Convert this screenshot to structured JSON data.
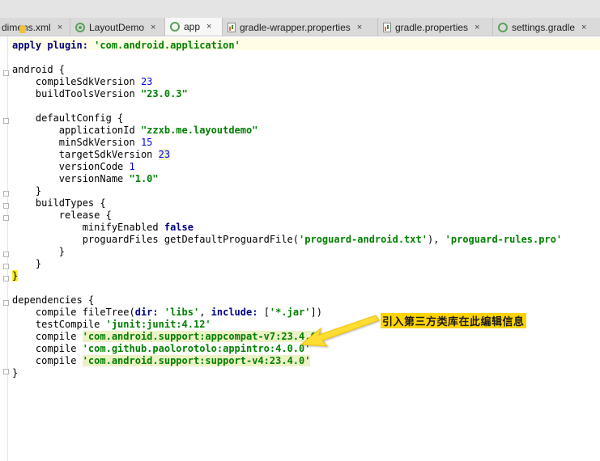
{
  "tabs": [
    {
      "label": "dimens.xml",
      "icon": "xml-file-icon",
      "active": false
    },
    {
      "label": "LayoutDemo",
      "icon": "android-module-icon",
      "active": false
    },
    {
      "label": "app",
      "icon": "gradle-module-icon",
      "active": true
    },
    {
      "label": "gradle-wrapper.properties",
      "icon": "properties-file-icon",
      "active": false
    },
    {
      "label": "gradle.properties",
      "icon": "properties-file-icon",
      "active": false
    },
    {
      "label": "settings.gradle",
      "icon": "gradle-module-icon",
      "active": false
    }
  ],
  "close_glyph": "×",
  "code": {
    "l1": {
      "a": "apply plugin: ",
      "s": "'com.android.application'"
    },
    "l3": "android {",
    "l4": {
      "a": "    compileSdkVersion ",
      "n": "23"
    },
    "l5": {
      "a": "    buildToolsVersion ",
      "s": "\"23.0.3\""
    },
    "l7": "    defaultConfig {",
    "l8": {
      "a": "        applicationId ",
      "s": "\"zzxb.me.layoutdemo\""
    },
    "l9": {
      "a": "        minSdkVersion ",
      "n": "15"
    },
    "l10": {
      "a": "        targetSdkVersion ",
      "n": "23"
    },
    "l11": {
      "a": "        versionCode ",
      "n": "1"
    },
    "l12": {
      "a": "        versionName ",
      "s": "\"1.0\""
    },
    "l13": "    }",
    "l14": "    buildTypes {",
    "l15": "        release {",
    "l16": {
      "a": "            minifyEnabled ",
      "k": "false"
    },
    "l17": {
      "a": "            proguardFiles getDefaultProguardFile(",
      "s1": "'proguard-android.txt'",
      "b": "), ",
      "s2": "'proguard-rules.pro'"
    },
    "l18": "        }",
    "l19": "    }",
    "l20": "}",
    "l22": "dependencies {",
    "l23": {
      "a": "    compile fileTree(",
      "k1": "dir: ",
      "s1": "'libs'",
      "b": ", ",
      "k2": "include: ",
      "c": "[",
      "s2": "'*.jar'",
      "d": "])"
    },
    "l24": {
      "a": "    testCompile ",
      "s": "'junit:junit:4.12'"
    },
    "l25": {
      "a": "    compile ",
      "s": "'com.android.support:appcompat-v7:23.4.0'"
    },
    "l26": {
      "a": "    compile ",
      "s": "'com.github.paolorotolo:appintro:4.0.0'"
    },
    "l27": {
      "a": "    compile ",
      "s": "'com.android.support:support-v4:23.4.0'"
    },
    "l28": "}"
  },
  "annotation": "引入第三方类库在此编辑信息",
  "colors": {
    "annotation_bg": "#ffd400",
    "arrow": "#ffdd33",
    "string": "#008000",
    "number": "#0000ff",
    "keyword": "#000080"
  }
}
